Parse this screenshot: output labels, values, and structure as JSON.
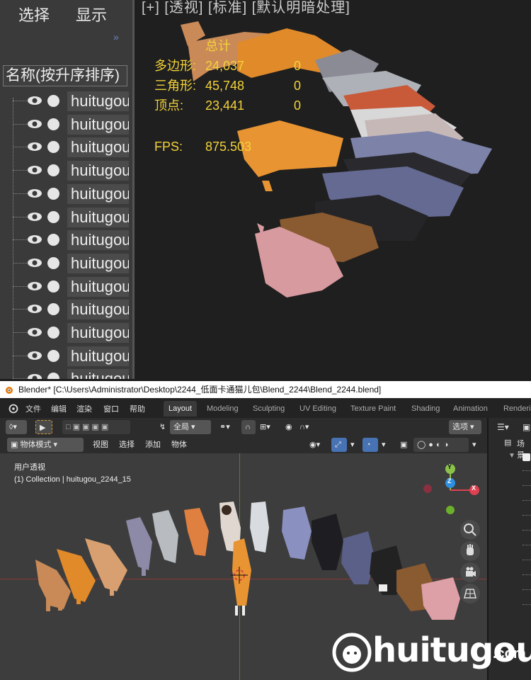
{
  "zoom_outliner": {
    "menu": [
      "选择",
      "显示"
    ],
    "sort_label": "名称(按升序排序)",
    "rows": [
      "huitugou",
      "huitugou",
      "huitugou",
      "huitugou",
      "huitugou",
      "huitugou",
      "huitugou",
      "huitugou",
      "huitugou",
      "huitugou",
      "huitugou",
      "huitugou",
      "huitugou"
    ]
  },
  "zoom_viewport": {
    "header": "[+] [透视] [标准] [默认明暗处理]",
    "stats": {
      "total_label": "总计",
      "poly_label": "多边形:",
      "poly_value": "24,037",
      "poly_sel": "0",
      "tri_label": "三角形:",
      "tri_value": "45,748",
      "tri_sel": "0",
      "vert_label": "顶点:",
      "vert_value": "23,441",
      "vert_sel": "0",
      "fps_label": "FPS:",
      "fps_value": "875.503"
    }
  },
  "titlebar": "Blender* [C:\\Users\\Administrator\\Desktop\\2244_低面卡通猫儿包\\Blend_2244\\Blend_2244.blend]",
  "menubar": {
    "items": [
      "文件",
      "编辑",
      "渲染",
      "窗口",
      "帮助"
    ],
    "workspaces": [
      "Layout",
      "Modeling",
      "Sculpting",
      "UV Editing",
      "Texture Paint",
      "Shading",
      "Animation",
      "Renderi"
    ]
  },
  "header1": {
    "transform": "全局",
    "select": "选项"
  },
  "header2": {
    "mode": "物体模式",
    "menus": [
      "视图",
      "选择",
      "添加",
      "物体"
    ],
    "right_label": "场景"
  },
  "viewport": {
    "view_name": "用户透视",
    "collection": "(1) Collection | huitugou_2244_15",
    "gizmo": {
      "y": "Y",
      "z": "Z",
      "x": "X"
    }
  },
  "watermark": {
    "text": "huitugou",
    "suffix": ".com"
  },
  "colors": {
    "accent": "#4772b3",
    "stats_yellow": "#f3d23a",
    "axis_x": "#e04050",
    "axis_y": "#8bc34a",
    "axis_z": "#2e8fe0"
  }
}
